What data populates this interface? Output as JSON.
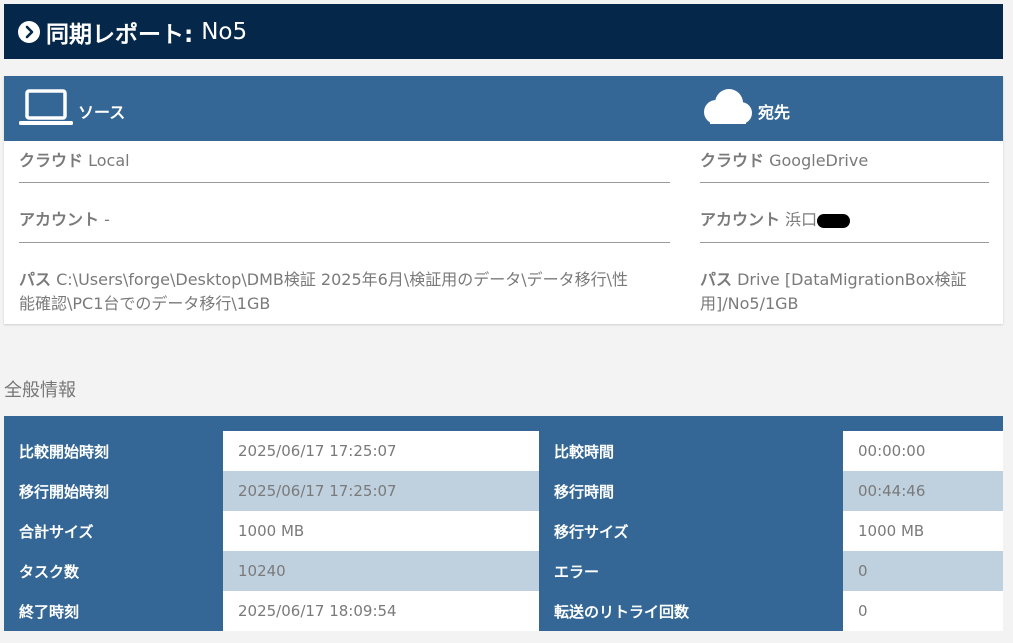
{
  "header": {
    "prefix": "同期レポート:",
    "name": "No5"
  },
  "source": {
    "heading": "ソース",
    "cloud_label": "クラウド",
    "cloud_value": "Local",
    "account_label": "アカウント",
    "account_value": "-",
    "path_label": "パス",
    "path_line1": "C:\\Users\\forge\\Desktop\\DMB検証 2025年6月\\検証用のデータ\\データ移行\\性",
    "path_line2": "能確認\\PC1台でのデータ移行\\1GB"
  },
  "destination": {
    "heading": "宛先",
    "cloud_label": "クラウド",
    "cloud_value": "GoogleDrive",
    "account_label": "アカウント",
    "account_value": "浜口",
    "path_label": "パス",
    "path_line1": "Drive [DataMigrationBox検証",
    "path_line2": "用]/No5/1GB"
  },
  "general": {
    "title": "全般情報",
    "rows": [
      {
        "l1": "比較開始時刻",
        "v1": "2025/06/17 17:25:07",
        "l2": "比較時間",
        "v2": "00:00:00"
      },
      {
        "l1": "移行開始時刻",
        "v1": "2025/06/17 17:25:07",
        "l2": "移行時間",
        "v2": "00:44:46"
      },
      {
        "l1": "合計サイズ",
        "v1": "1000 MB",
        "l2": "移行サイズ",
        "v2": "1000 MB"
      },
      {
        "l1": "タスク数",
        "v1": "10240",
        "l2": "エラー",
        "v2": "0"
      },
      {
        "l1": "終了時刻",
        "v1": "2025/06/17 18:09:54",
        "l2": "転送のリトライ回数",
        "v2": "0"
      }
    ]
  },
  "icons": {
    "header": "chevron-right-circle-icon",
    "source": "laptop-icon",
    "destination": "cloud-icon"
  },
  "colors": {
    "header_bg": "#04274a",
    "accent": "#346795",
    "alt_row": "#bfd0df"
  }
}
